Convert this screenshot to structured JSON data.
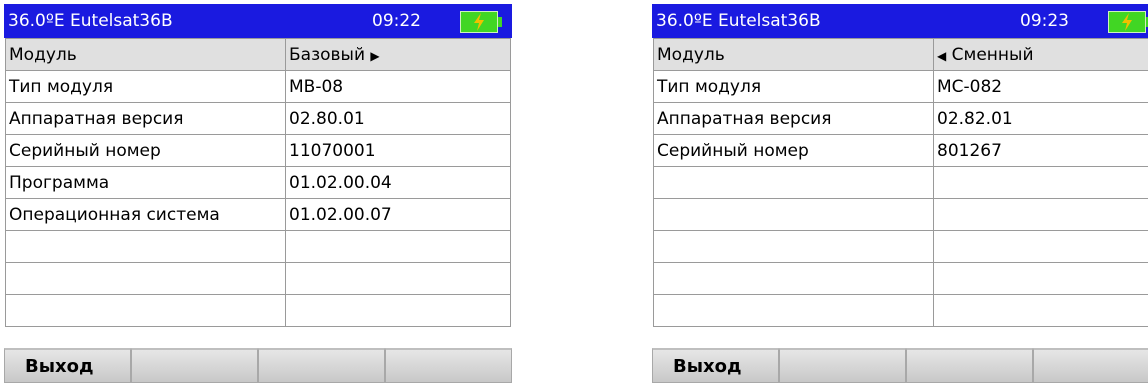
{
  "left": {
    "satellite": "36.0ºE Eutelsat36B",
    "time": "09:22",
    "header": {
      "label": "Модуль",
      "value": "Базовый",
      "arrow": "▶"
    },
    "rows": [
      {
        "label": "Тип модуля",
        "value": "MB-08"
      },
      {
        "label": "Аппаратная версия",
        "value": "02.80.01"
      },
      {
        "label": "Серийный номер",
        "value": "11070001"
      },
      {
        "label": "Программа",
        "value": "01.02.00.04"
      },
      {
        "label": "Операционная система",
        "value": "01.02.00.07"
      },
      {
        "label": "",
        "value": ""
      },
      {
        "label": "",
        "value": ""
      },
      {
        "label": "",
        "value": ""
      }
    ],
    "softkeys": [
      "Выход",
      "",
      "",
      ""
    ]
  },
  "right": {
    "satellite": "36.0ºE Eutelsat36B",
    "time": "09:23",
    "header": {
      "label": "Модуль",
      "value": "Сменный",
      "arrow": "◀"
    },
    "rows": [
      {
        "label": "Тип модуля",
        "value": "MC-082"
      },
      {
        "label": "Аппаратная версия",
        "value": "02.82.01"
      },
      {
        "label": "Серийный номер",
        "value": "801267"
      },
      {
        "label": "",
        "value": ""
      },
      {
        "label": "",
        "value": ""
      },
      {
        "label": "",
        "value": ""
      },
      {
        "label": "",
        "value": ""
      },
      {
        "label": "",
        "value": ""
      }
    ],
    "softkeys": [
      "Выход",
      "",
      "",
      ""
    ]
  },
  "colors": {
    "titlebar": "#1a1ae0",
    "battery": "#41d624",
    "bolt": "#f0c000"
  },
  "icons": {
    "battery": "battery-charging-icon"
  }
}
